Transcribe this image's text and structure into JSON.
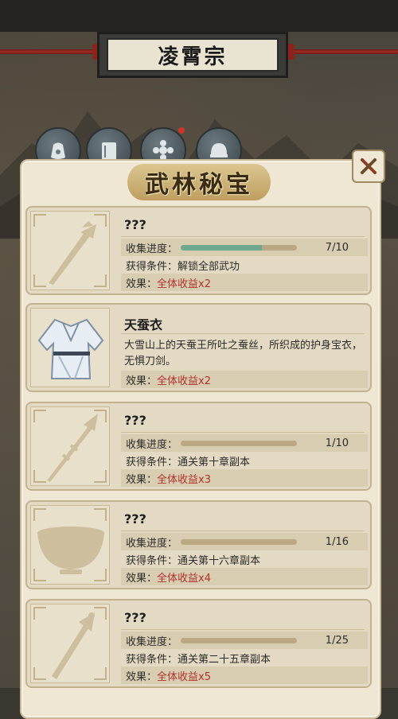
{
  "title": "凌霄宗",
  "panel": {
    "title": "武林秘宝"
  },
  "nav": {
    "icons": [
      "bag-icon",
      "book-icon",
      "flower-emblem-icon",
      "helmet-icon"
    ]
  },
  "labels": {
    "progress": "收集进度：",
    "condition": "获得条件：",
    "effect": "效果："
  },
  "cards": [
    {
      "name": "???",
      "icon": "sword-icon",
      "progress_text": "7/10",
      "progress_fraction": 0.7,
      "condition": "解锁全部武功",
      "effect": "全体收益x2"
    },
    {
      "name": "天蚕衣",
      "icon": "robe-icon",
      "description": "大雪山上的天蚕王所吐之蚕丝，所织成的护身宝衣，无惧刀剑。",
      "effect": "全体收益x2"
    },
    {
      "name": "???",
      "icon": "spear-icon",
      "progress_text": "1/10",
      "progress_fraction": 0.1,
      "condition": "通关第十章副本",
      "effect": "全体收益x3"
    },
    {
      "name": "???",
      "icon": "bowl-icon",
      "progress_text": "1/16",
      "progress_fraction": 0.0625,
      "condition": "通关第十六章副本",
      "effect": "全体收益x4"
    },
    {
      "name": "???",
      "icon": "dagger-icon",
      "progress_text": "1/25",
      "progress_fraction": 0.04,
      "condition": "通关第二十五章副本",
      "effect": "全体收益x5"
    }
  ]
}
